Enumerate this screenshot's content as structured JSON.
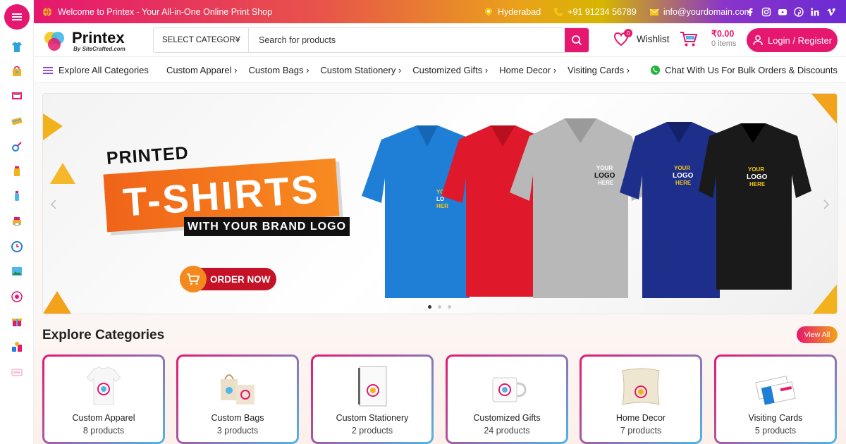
{
  "topbar": {
    "welcome": "Welcome to Printex - Your All-in-One Online Print Shop",
    "location": "Hyderabad",
    "phone": "+91 91234 56789",
    "email": "info@yourdomain.com",
    "socials": [
      "facebook-icon",
      "instagram-icon",
      "youtube-icon",
      "pinterest-icon",
      "linkedin-icon",
      "vimeo-icon"
    ]
  },
  "header": {
    "logo_name": "Printex",
    "logo_sub": "By SiteCrafted.com",
    "search_category": "SELECT CATEGORY",
    "search_placeholder": "Search for products",
    "wishlist_label": "Wishlist",
    "wishlist_count": "0",
    "cart_amount": "₹0.00",
    "cart_items": "0 items",
    "login_label": "Login / Register"
  },
  "nav": {
    "explore_all": "Explore All Categories",
    "links": [
      "Custom Apparel ›",
      "Custom Bags ›",
      "Custom Stationery ›",
      "Customized Gifts ›",
      "Home Decor ›",
      "Visiting Cards ›"
    ],
    "chat": "Chat With Us For Bulk Orders & Discounts"
  },
  "banner": {
    "line1": "PRINTED",
    "line2": "T-SHIRTS",
    "line3": "WITH YOUR BRAND LOGO",
    "cta": "ORDER NOW",
    "shirt_logo_text": [
      "YOUR",
      "LOGO",
      "HERE"
    ],
    "slide_count": 3,
    "active_slide": 0
  },
  "categories": {
    "title": "Explore Categories",
    "view_all": "View All",
    "items": [
      {
        "name": "Custom Apparel",
        "count": "8 products"
      },
      {
        "name": "Custom Bags",
        "count": "3 products"
      },
      {
        "name": "Custom Stationery",
        "count": "2 products"
      },
      {
        "name": "Customized Gifts",
        "count": "24 products"
      },
      {
        "name": "Home Decor",
        "count": "7 products"
      },
      {
        "name": "Visiting Cards",
        "count": "5 products"
      }
    ]
  },
  "colors": {
    "brand": "#e5176f",
    "accent_orange": "#f06419",
    "shirts": [
      "#1f7fd6",
      "#e0182b",
      "#b8b8b8",
      "#1d2f8a",
      "#1a1a1a"
    ]
  }
}
